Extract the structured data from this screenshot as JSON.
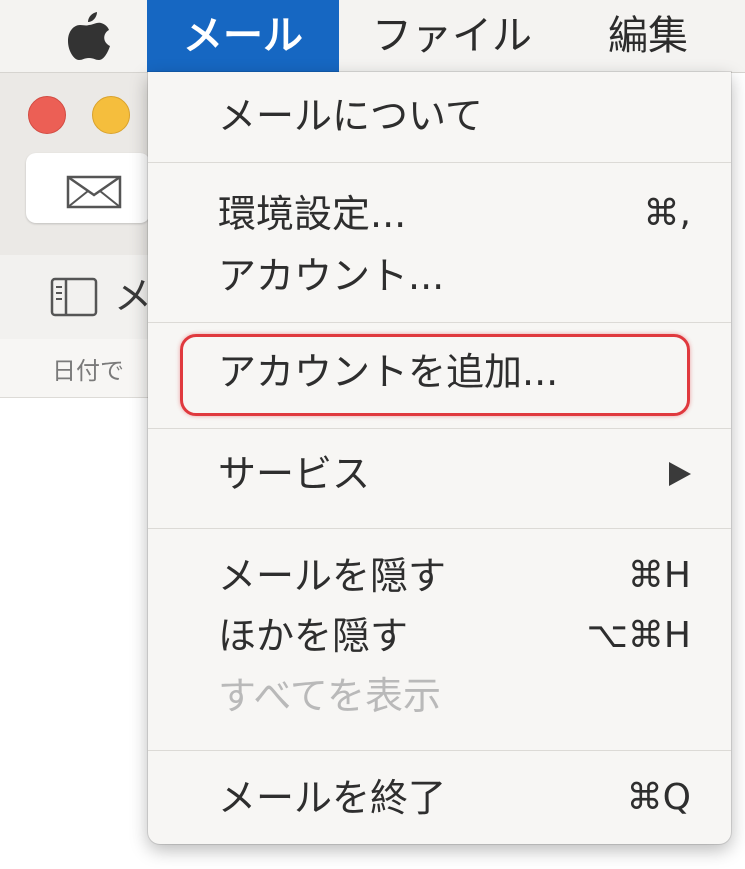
{
  "menubar": {
    "apple_icon": "apple-logo-icon",
    "items": [
      {
        "label": "メール",
        "active": true
      },
      {
        "label": "ファイル"
      },
      {
        "label": "編集"
      }
    ]
  },
  "window": {
    "compose_icon": "envelope-icon",
    "sidebar_icon": "sidebar-toggle-icon",
    "mailboxes_partial_label": "メ",
    "sort_partial_label": "日付で"
  },
  "dropdown": {
    "items": [
      {
        "label": "メールについて",
        "shortcut": ""
      },
      {
        "label": "環境設定...",
        "shortcut": "⌘,"
      },
      {
        "label": "アカウント...",
        "shortcut": ""
      },
      {
        "label": "アカウントを追加...",
        "shortcut": "",
        "highlighted": true
      },
      {
        "label": "サービス",
        "shortcut": "",
        "submenu": true
      },
      {
        "label": "メールを隠す",
        "shortcut": "⌘H"
      },
      {
        "label": "ほかを隠す",
        "shortcut": "⌥⌘H"
      },
      {
        "label": "すべてを表示",
        "shortcut": "",
        "disabled": true
      },
      {
        "label": "メールを終了",
        "shortcut": "⌘Q"
      }
    ]
  },
  "colors": {
    "menu_active_bg": "#1667c2",
    "highlight_outline": "#e0393e",
    "traffic_close": "#ec5f55",
    "traffic_minimize": "#f5be3d"
  }
}
